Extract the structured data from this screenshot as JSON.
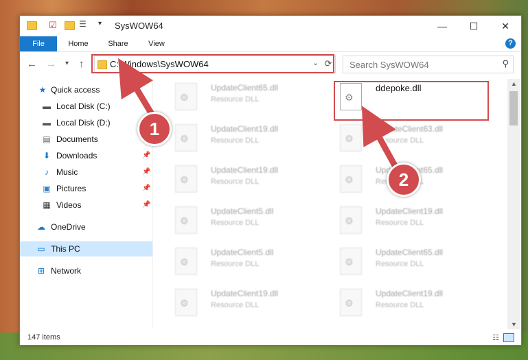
{
  "window": {
    "title": "SysWOW64",
    "controls": {
      "minimize": "—",
      "maximize": "☐",
      "close": "✕"
    }
  },
  "ribbon": {
    "tabs": [
      "File",
      "Home",
      "Share",
      "View"
    ],
    "help": "?"
  },
  "address": {
    "path": "C:\\Windows\\SysWOW64",
    "search_placeholder": "Search SysWOW64"
  },
  "sidebar": {
    "items": [
      {
        "label": "Quick access",
        "icon": "star-icon"
      },
      {
        "label": "Local Disk (C:)",
        "icon": "drive-icon"
      },
      {
        "label": "Local Disk (D:)",
        "icon": "drive-icon"
      },
      {
        "label": "Documents",
        "icon": "documents-icon"
      },
      {
        "label": "Downloads",
        "icon": "download-icon"
      },
      {
        "label": "Music",
        "icon": "music-icon"
      },
      {
        "label": "Pictures",
        "icon": "pictures-icon"
      },
      {
        "label": "Videos",
        "icon": "videos-icon"
      },
      {
        "label": "OneDrive",
        "icon": "cloud-icon"
      },
      {
        "label": "This PC",
        "icon": "computer-icon"
      },
      {
        "label": "Network",
        "icon": "network-icon"
      }
    ]
  },
  "files": {
    "left": [
      {
        "name": "UpdateClient65.dll",
        "type": "Resource DLL"
      },
      {
        "name": "UpdateClient19.dll",
        "type": "Resource DLL"
      },
      {
        "name": "UpdateClient19.dll",
        "type": "Resource DLL"
      },
      {
        "name": "UpdateClient5.dll",
        "type": "Resource DLL"
      },
      {
        "name": "UpdateClient5.dll",
        "type": "Resource DLL"
      },
      {
        "name": "UpdateClient19.dll",
        "type": "Resource DLL"
      }
    ],
    "right": [
      {
        "name": "ddepoke.dll",
        "type": ""
      },
      {
        "name": "UpdateClient63.dll",
        "type": "Resource DLL"
      },
      {
        "name": "UpdateClient65.dll",
        "type": "Resource DLL"
      },
      {
        "name": "UpdateClient19.dll",
        "type": "Resource DLL"
      },
      {
        "name": "UpdateClient65.dll",
        "type": "Resource DLL"
      },
      {
        "name": "UpdateClient19.dll",
        "type": "Resource DLL"
      }
    ]
  },
  "status": {
    "count": "147 items"
  },
  "annotations": {
    "badge1": "1",
    "badge2": "2",
    "color": "#d24b4e"
  }
}
